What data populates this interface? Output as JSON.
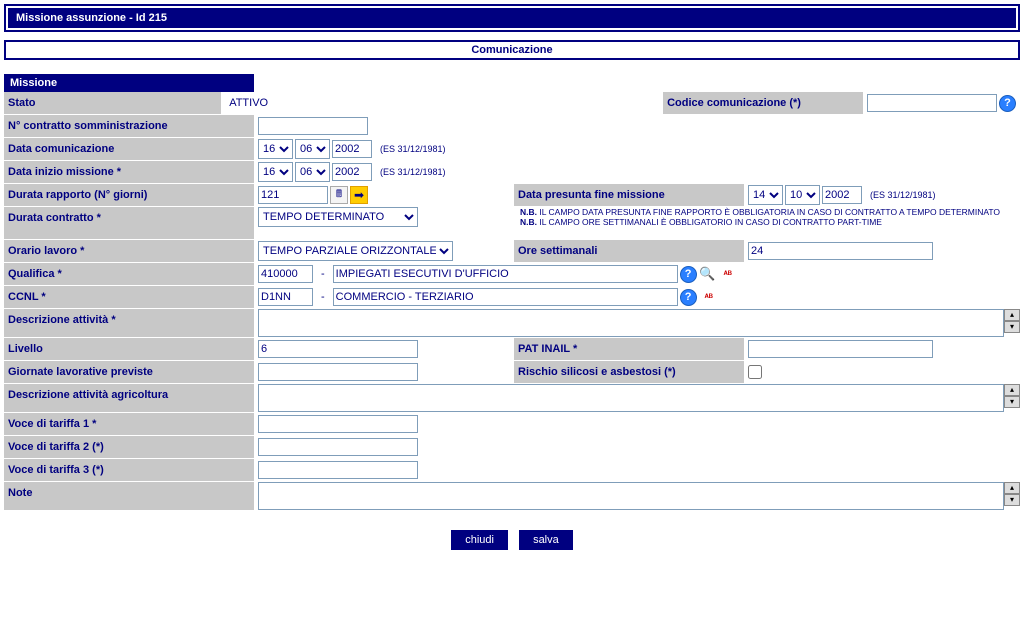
{
  "header": {
    "title": "Missione assunzione - Id 215"
  },
  "comm": {
    "title": "Comunicazione"
  },
  "section": {
    "missione": "Missione"
  },
  "labels": {
    "stato": "Stato",
    "codice_com": "Codice comunicazione (*)",
    "n_contratto": "N° contratto somministrazione",
    "data_com": "Data comunicazione",
    "data_inizio": "Data inizio missione *",
    "durata_rapporto": "Durata rapporto (N° giorni)",
    "data_fine": "Data presunta fine missione",
    "durata_contratto": "Durata contratto *",
    "orario": "Orario lavoro *",
    "ore": "Ore settimanali",
    "qualifica": "Qualifica *",
    "ccnl": "CCNL *",
    "desc_attivita": "Descrizione attività *",
    "livello": "Livello",
    "pat_inail": "PAT INAIL *",
    "giornate": "Giornate lavorative previste",
    "rischio": "Rischio silicosi e asbestosi (*)",
    "desc_agri": "Descrizione attività agricoltura",
    "voce1": "Voce di tariffa 1 *",
    "voce2": "Voce di tariffa 2 (*)",
    "voce3": "Voce di tariffa 3 (*)",
    "note": "Note"
  },
  "values": {
    "stato": "ATTIVO",
    "codice_com": "",
    "n_contratto": "",
    "data_com_d": "16",
    "data_com_m": "06",
    "data_com_y": "2002",
    "data_inizio_d": "16",
    "data_inizio_m": "06",
    "data_inizio_y": "2002",
    "durata_rapporto": "121",
    "data_fine_d": "14",
    "data_fine_m": "10",
    "data_fine_y": "2002",
    "durata_contratto": "TEMPO DETERMINATO",
    "orario": "TEMPO PARZIALE ORIZZONTALE",
    "ore": "24",
    "qualifica_code": "410000",
    "qualifica_desc": "IMPIEGATI ESECUTIVI D'UFFICIO",
    "ccnl_code": "D1NN",
    "ccnl_desc": "COMMERCIO - TERZIARIO",
    "desc_attivita": "",
    "livello": "6",
    "pat_inail": "",
    "giornate": "",
    "desc_agri": "",
    "voce1": "",
    "voce2": "",
    "voce3": "",
    "note": ""
  },
  "hints": {
    "date_example": "(ES 31/12/1981)",
    "nb1": "N.B. IL CAMPO DATA PRESUNTA FINE RAPPORTO È OBBLIGATORIA IN CASO DI CONTRATTO A TEMPO DETERMINATO",
    "nb2": "N.B. IL CAMPO ORE SETTIMANALI È OBBLIGATORIO IN CASO DI CONTRATTO PART-TIME"
  },
  "buttons": {
    "chiudi": "chiudi",
    "salva": "salva"
  }
}
